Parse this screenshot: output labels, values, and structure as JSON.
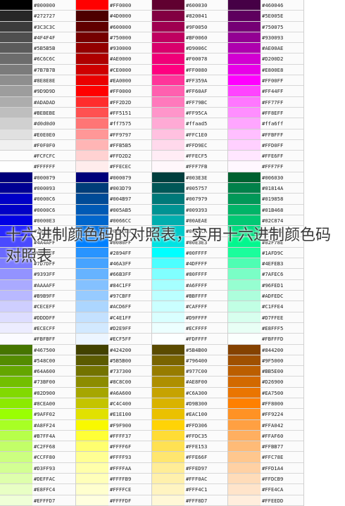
{
  "title": "十六进制颜色码的对照表，实用十六进制颜色码对照表",
  "columns": [
    [
      "#000000",
      "#272727",
      "#3C3C3C",
      "#4F4F4F",
      "#5B5B5B",
      "#6C6C6C",
      "#7B7B7B",
      "#8E8E8E",
      "#9D9D9D",
      "#ADADAD",
      "#BEBEBE",
      "#d0d0d0",
      "#E0E0E0",
      "#F0F0F0",
      "#FCFCFC",
      "#FFFFFF",
      "#000079",
      "#000093",
      "#0000C6",
      "#0000C6",
      "#0000E3",
      "#2828FF",
      "#4A4AFF",
      "#6A6AFF",
      "#7D7DFF",
      "#9393FF",
      "#AAAAFF",
      "#B9B9FF",
      "#CECEFF",
      "#DDDDFF",
      "#ECECFF",
      "#FBFBFF",
      "#467500",
      "#548C00",
      "#64A600",
      "#73BF00",
      "#82D900",
      "#8CEA00",
      "#9AFF02",
      "#A8FF24",
      "#B7FF4A",
      "#C2FF68",
      "#CCFF80",
      "#D3FF93",
      "#DEFFAC",
      "#E8FFC4",
      "#EFFFD7"
    ],
    [
      "#FF0000",
      "#4D0000",
      "#600000",
      "#750000",
      "#930000",
      "#AE0000",
      "#CE0000",
      "#EA0000",
      "#FF0000",
      "#FF2D2D",
      "#FF5151",
      "#ff7575",
      "#FF9797",
      "#FFB5B5",
      "#FFD2D2",
      "#FFECEC",
      "#000079",
      "#003D79",
      "#004B97",
      "#005AB5",
      "#0066CC",
      "#0072E3",
      "#0080FF",
      "#2894FF",
      "#46A3FF",
      "#66B3FF",
      "#84C1FF",
      "#97CBFF",
      "#ACD6FF",
      "#C4E1FF",
      "#D2E9FF",
      "#ECF5FF",
      "#424200",
      "#5B5B00",
      "#737300",
      "#8C8C00",
      "#A6A600",
      "#C4C400",
      "#E1E100",
      "#F9F900",
      "#FFFF37",
      "#FFFF6F",
      "#FFFF93",
      "#FFFFAA",
      "#FFFFB9",
      "#FFFFCE",
      "#FFFFDF"
    ],
    [
      "#600030",
      "#820041",
      "#9F0050",
      "#BF0060",
      "#D9006C",
      "#F00078",
      "#FF0080",
      "#FF359A",
      "#FF60AF",
      "#FF79BC",
      "#FF95CA",
      "#ffaad5",
      "#FFC1E0",
      "#FFD9EC",
      "#FFECF5",
      "#FFF7FB",
      "#003E3E",
      "#005757",
      "#007979",
      "#009393",
      "#00AEAE",
      "#00CACA",
      "#00E3E3",
      "#00FFFF",
      "#4DFFFF",
      "#80FFFF",
      "#A6FFFF",
      "#BBFFFF",
      "#CAFFFF",
      "#D9FFFF",
      "#ECFFFF",
      "#FDFFFF",
      "#5B4B00",
      "#796400",
      "#977C00",
      "#AE8F00",
      "#C6A300",
      "#D9B300",
      "#EAC100",
      "#FFD306",
      "#FFDC35",
      "#FFE153",
      "#FFE66F",
      "#FFED97",
      "#FFF0AC",
      "#FFF4C1",
      "#FFF8D7"
    ],
    [
      "#460046",
      "#5E005E",
      "#750075",
      "#930093",
      "#AE00AE",
      "#D200D2",
      "#E800E8",
      "#FF00FF",
      "#FF44FF",
      "#FF77FF",
      "#FF8EFF",
      "#ffa6ff",
      "#FFBFFF",
      "#FFD0FF",
      "#FFE6FF",
      "#FFF7FF",
      "#006030",
      "#01814A",
      "#019858",
      "#01B468",
      "#02C874",
      "#02DF82",
      "#02F78E",
      "#1AFD9C",
      "#4EFEB3",
      "#7AFEC6",
      "#96FED1",
      "#ADFEDC",
      "#C1FFE4",
      "#D7FFEE",
      "#E8FFF5",
      "#FBFFFD",
      "#844200",
      "#9F5000",
      "#BB5E00",
      "#D26900",
      "#EA7500",
      "#FF8000",
      "#FF9224",
      "#FFA042",
      "#FFAF60",
      "#FFBB77",
      "#FFC78E",
      "#FFD1A4",
      "#FFDCB9",
      "#FFE4CA",
      "#FFEEDD"
    ]
  ]
}
